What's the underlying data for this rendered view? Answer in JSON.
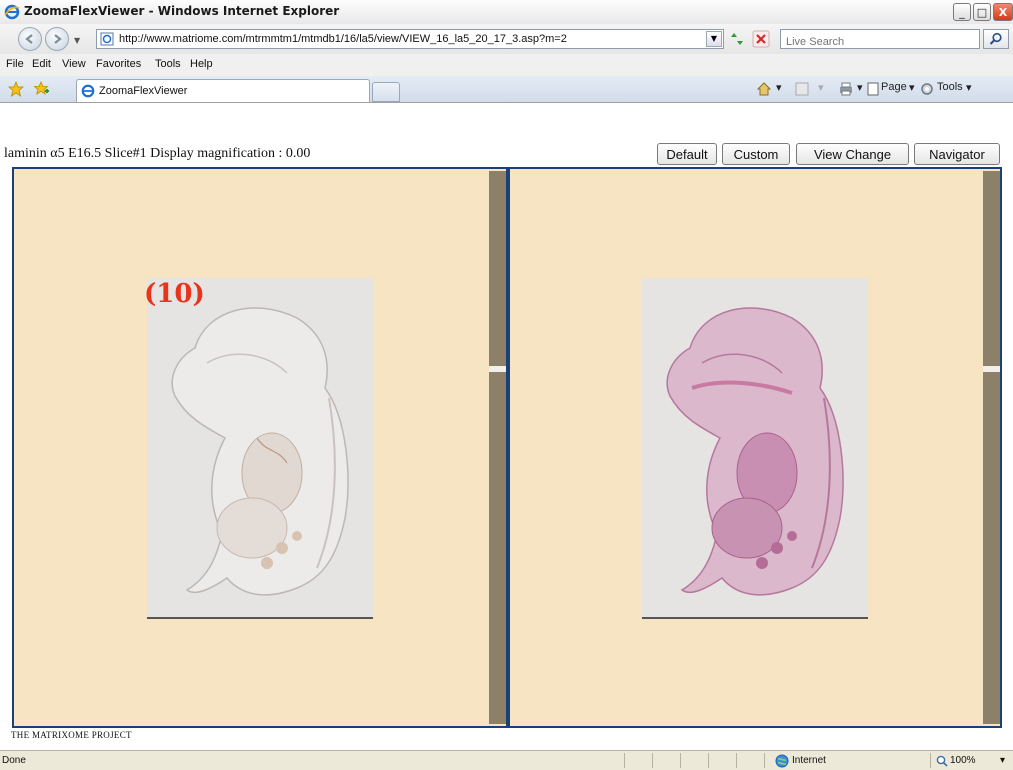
{
  "window": {
    "title": "ZoomaFlexViewer - Windows Internet Explorer",
    "minimize_glyph": "_",
    "maximize_glyph": "□",
    "close_glyph": "X"
  },
  "address_bar": {
    "url": "http://www.matriome.com/mtrmmtm1/mtmdb1/16/la5/view/VIEW_16_la5_20_17_3.asp?m=2",
    "search_placeholder": "Live Search"
  },
  "menu": {
    "items": [
      "File",
      "Edit",
      "View",
      "Favorites",
      "Tools",
      "Help"
    ]
  },
  "tabs": {
    "active_label": "ZoomaFlexViewer",
    "page_label": "Page",
    "tools_label": "Tools"
  },
  "viewer": {
    "title": "laminin α5 E16.5 Slice#1 Display magnification : 0.00",
    "buttons": {
      "default": "Default",
      "custom": "Custom",
      "view_change": "View Change",
      "navigator": "Navigator"
    },
    "left_panel_label": "(10)",
    "footer": "THE MATRIXOME PROJECT"
  },
  "status": {
    "text": "Done",
    "zone": "Internet",
    "zoom": "100%"
  },
  "colors": {
    "panel_bg": "#f6e4c3",
    "panel_border": "#1b3f7a",
    "scroll_track": "#8c8168",
    "label_red": "#e8341c"
  }
}
